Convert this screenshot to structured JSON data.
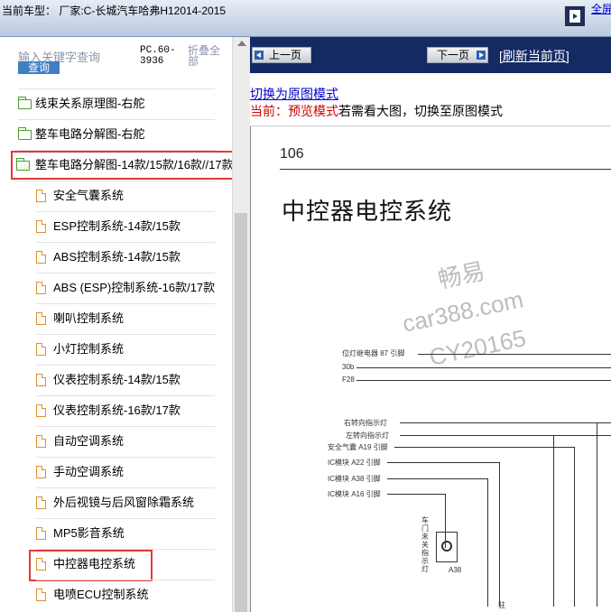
{
  "topbar": {
    "car_model": "当前车型： 厂家:C-长城汽车哈弗H12014-2015",
    "full_menu_link": "全屏菜单"
  },
  "sidebar": {
    "search_placeholder": "输入关键字查询",
    "query_button": "查询",
    "pc_code": "PC.60-3936",
    "collapse_all": "折叠全部",
    "folders": [
      {
        "label": "线束关系原理图-右舵"
      },
      {
        "label": "整车电路分解图-右舵"
      },
      {
        "label": "整车电路分解图-14款/15款/16款//17款"
      }
    ],
    "docs": [
      {
        "label": "安全气囊系统"
      },
      {
        "label": "ESP控制系统-14款/15款"
      },
      {
        "label": "ABS控制系统-14款/15款"
      },
      {
        "label": "ABS (ESP)控制系统-16款/17款"
      },
      {
        "label": "喇叭控制系统"
      },
      {
        "label": "小灯控制系统"
      },
      {
        "label": "仪表控制系统-14款/15款"
      },
      {
        "label": "仪表控制系统-16款/17款"
      },
      {
        "label": "自动空调系统"
      },
      {
        "label": "手动空调系统"
      },
      {
        "label": "外后视镜与后风窗除霜系统"
      },
      {
        "label": "MP5影音系统"
      },
      {
        "label": "中控器电控系统"
      },
      {
        "label": "电喷ECU控制系统"
      }
    ]
  },
  "viewer": {
    "prev_button": "上一页",
    "next_button": "下一页",
    "refresh_link": "[刷新当前页]",
    "switch_link": "切换为原图模式",
    "preview_prefix": "当前：预览模式",
    "preview_suffix": "若需看大图，切换至原图模式",
    "page_number": "106",
    "page_title": "中控器电控系统",
    "watermark": [
      "畅易",
      "car388.com",
      "CY20165"
    ],
    "diagram_labels": [
      "位灯继电器 87 引脚",
      "30b",
      "F28",
      "右转向指示灯",
      "左转向指示灯",
      "安全气囊 A19 引脚",
      "IC模块 A22 引脚",
      "IC模块 A38 引脚",
      "IC模块 A16 引脚",
      "车门未关指示灯",
      "A38",
      "驻"
    ]
  }
}
